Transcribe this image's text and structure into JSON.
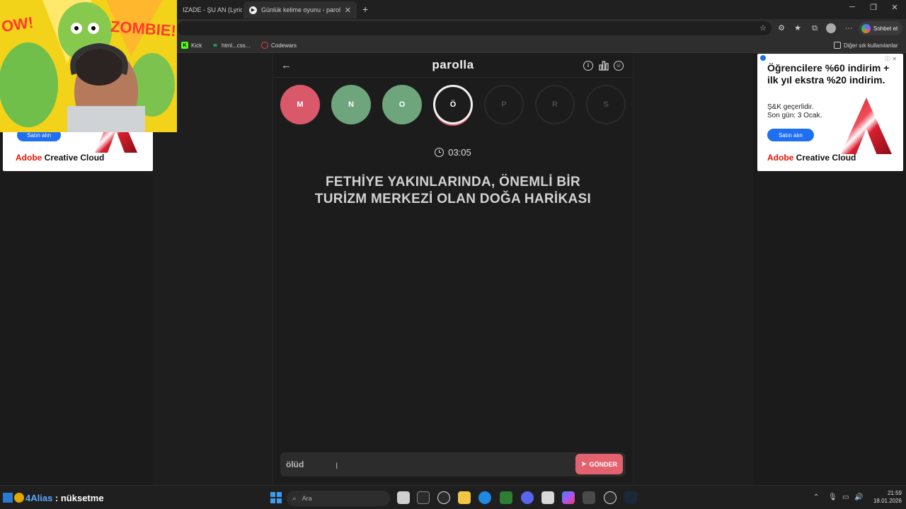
{
  "browser": {
    "tabs": [
      {
        "label": "IZADE - ŞU AN (Lyric",
        "active": false
      },
      {
        "label": "Günlük kelime oyunu - parolla - Ki",
        "active": true
      }
    ],
    "new_tab_label": "+",
    "bookmarks": [
      {
        "label": "Kick",
        "icon": "kick-icon"
      },
      {
        "label": "html...css...",
        "icon": "w-icon"
      },
      {
        "label": "Codewars",
        "icon": "codewars-icon"
      }
    ],
    "other_bookmarks_label": "Diğer sık kullanılanlar",
    "copilot_label": "Sohbet et"
  },
  "app": {
    "title": "parolla",
    "letters": [
      {
        "char": "M",
        "state": "wrong"
      },
      {
        "char": "N",
        "state": "right"
      },
      {
        "char": "O",
        "state": "right"
      },
      {
        "char": "Ö",
        "state": "current"
      },
      {
        "char": "P",
        "state": "pending"
      },
      {
        "char": "R",
        "state": "pending"
      },
      {
        "char": "S",
        "state": "pending"
      }
    ],
    "timer": "03:05",
    "question": "FETHİYE YAKINLARINDA, ÖNEMLİ BİR TURİZM MERKEZİ OLAN DOĞA HARİKASI",
    "answer_value": "ölüd",
    "send_label": "GÖNDER"
  },
  "ads": {
    "left": {
      "button": "Satın alın",
      "brand_red": "Adobe",
      "brand_rest": " Creative Cloud"
    },
    "right": {
      "headline": "Öğrencilere %60 indirim + ilk yıl ekstra %20 indirim.",
      "sub1": "Ş&K geçerlidir.",
      "sub2": "Son gün: 3 Ocak.",
      "button": "Satın alın",
      "brand_red": "Adobe",
      "brand_rest": " Creative Cloud"
    }
  },
  "webcam": {
    "banner_left": "OW!",
    "banner_right": "ZOMBIE!"
  },
  "taskbar": {
    "overlay_alias": "4Alias",
    "overlay_rest": " : nüksetme",
    "search_placeholder": "Ara",
    "time": "21:59",
    "date": "18.01.2026"
  },
  "colors": {
    "wrong": "#d9596a",
    "right": "#6fa57d",
    "send": "#e4626f",
    "adobe_red": "#eb1000"
  }
}
